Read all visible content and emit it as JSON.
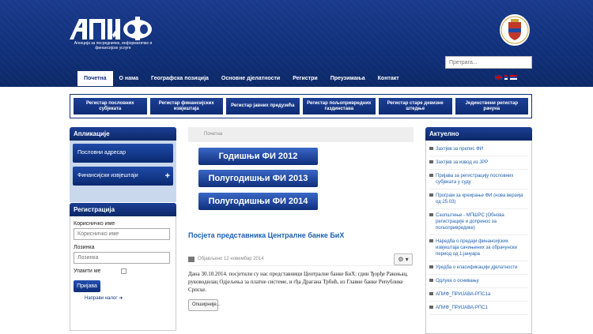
{
  "header": {
    "logo": "АПИФ",
    "tagline": "Агенција за посредничке, информатичке и финансијске услуге",
    "search_placeholder": "Претрага...",
    "nav": [
      "Почетна",
      "О нама",
      "Географска позиција",
      "Основне дјелатности",
      "Регистри",
      "Преузимања",
      "Контакт"
    ]
  },
  "registers": [
    "Регистар пословних субјеката",
    "Регистар финансијских извјештаја",
    "Регистар јавних предузећа",
    "Регистар пољопривредних газдинстава",
    "Регистар старе девизне штедње",
    "Јединствени регистар рачуна"
  ],
  "apps": {
    "title": "Апликације",
    "items": [
      "Пословни адресар",
      "Финансијски извјештаји"
    ],
    "plus": "+"
  },
  "registration": {
    "title": "Регистрација",
    "username_label": "Корисничко име",
    "username_placeholder": "Корисничко име",
    "password_label": "Лозинка",
    "password_placeholder": "Лозинка",
    "remember": "Упамти ме",
    "login": "Пријава",
    "new_account": "Направи налог"
  },
  "main": {
    "breadcrumb": "Почетна",
    "fi_buttons": [
      "Годишњи ФИ 2012",
      "Полугодишњи ФИ 2013",
      "Полугодишњи ФИ 2014"
    ],
    "post_title": "Посјета представника Централне банке БиХ",
    "post_date": "Објављено 12 новембар 2014",
    "post_body": "Дана 30.10.2014. посјетили су нас представници Централне банке БиХ: гдин Ђорђе Ракоњац, руководилац Одјељења за платне системе, и гђа Драгана Трбић, из Главне банке Републике Српске.",
    "more": "Опширније..."
  },
  "news": {
    "title": "Актуелно",
    "items": [
      "Захтјев за препис ФИ",
      "Захтјев за извод из ЈРР",
      "Пријава за регистрацију пословних субјеката у суду",
      "Програм за креирање ФИ (нова верзија од 25.03)",
      "Саопштење - МПШРС (Обнова регистрације и допринос за пољопривредике)",
      "Наредба о предаји финансијских извјештаја сачињених за обрачунски период од 1.јануара",
      "Уредба о класификацији дјелатности",
      "Одлука о оснивању",
      "АПИФ_ПРИЈАВА-РПС1а",
      "АПИФ_ПРИЈАВА-РПС1"
    ]
  }
}
